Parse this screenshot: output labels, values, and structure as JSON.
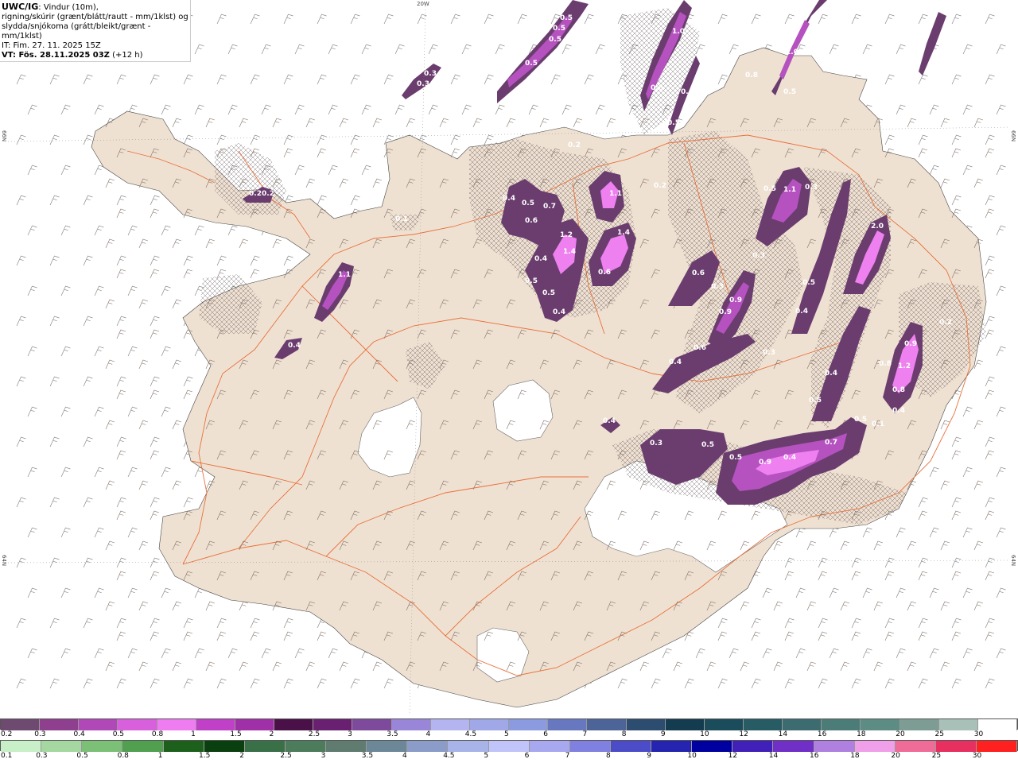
{
  "info": {
    "code": "UWC/IG",
    "line1": ": Vindur (10m),",
    "line2": "rigning/skúrir (grænt/blátt/rautt - mm/1klst) og",
    "line3": "slydda/snjókoma (grátt/bleikt/grænt - mm/1klst)",
    "it": "IT: Fim. 27. 11. 2025 15Z",
    "vt_prefix": "VT: Fös. 28.11.2025 03Z",
    "vt_offset": " (+12 h)"
  },
  "edge_labels": {
    "top_lon": "20W",
    "left_lat_upper": "66N",
    "left_lat_lower": "64N",
    "right_lat_upper": "66N",
    "right_lat_lower": "64N"
  },
  "colors": {
    "land": "#efe1d2",
    "sea": "#ffffff",
    "glacier": "#ffffff",
    "roads": "#e8703a",
    "snow_dark": "#6a3d6e",
    "snow_mid": "#b552c0",
    "snow_light": "#ee80f0"
  },
  "precip_labels": [
    {
      "text": "0.5"
    },
    {
      "text": "0.5"
    },
    {
      "text": "0.5"
    },
    {
      "text": "0.5"
    },
    {
      "text": "0.3"
    },
    {
      "text": "0.3"
    },
    {
      "text": "1.0"
    },
    {
      "text": "0.4"
    },
    {
      "text": "0.8"
    },
    {
      "text": "0.4"
    },
    {
      "text": "0.5"
    },
    {
      "text": "1.0"
    },
    {
      "text": "0.5"
    },
    {
      "text": "0.8"
    },
    {
      "text": "0.5"
    },
    {
      "text": "0.2"
    },
    {
      "text": "0.2"
    },
    {
      "text": "0.1"
    },
    {
      "text": "1.1"
    },
    {
      "text": "0.4"
    },
    {
      "text": "0.5"
    },
    {
      "text": "0.7"
    },
    {
      "text": "0.6"
    },
    {
      "text": "1.2"
    },
    {
      "text": "1.4"
    },
    {
      "text": "0.4"
    },
    {
      "text": "1.1"
    },
    {
      "text": "1.4"
    },
    {
      "text": "0.6"
    },
    {
      "text": "0.5"
    },
    {
      "text": "0.5"
    },
    {
      "text": "0.4"
    },
    {
      "text": "0.2"
    },
    {
      "text": "0.5"
    },
    {
      "text": "1.1"
    },
    {
      "text": "0.3"
    },
    {
      "text": "0.3"
    },
    {
      "text": "0.6"
    },
    {
      "text": "0.3"
    },
    {
      "text": "0.9"
    },
    {
      "text": "0.9"
    },
    {
      "text": "0.5"
    },
    {
      "text": "0.4"
    },
    {
      "text": "2.0"
    },
    {
      "text": "0.6"
    },
    {
      "text": "0.4"
    },
    {
      "text": "0.3"
    },
    {
      "text": "0.4"
    },
    {
      "text": "0.5"
    },
    {
      "text": "0.5"
    },
    {
      "text": "0.4"
    },
    {
      "text": "0.3"
    },
    {
      "text": "0.5"
    },
    {
      "text": "0.5"
    },
    {
      "text": "0.9"
    },
    {
      "text": "0.4"
    },
    {
      "text": "0.8"
    },
    {
      "text": "1.2"
    },
    {
      "text": "0.8"
    },
    {
      "text": "0.9"
    },
    {
      "text": "0.4"
    },
    {
      "text": "0.1"
    },
    {
      "text": "0.4"
    },
    {
      "text": "0.7"
    },
    {
      "text": "0.2"
    },
    {
      "text": "0.2"
    }
  ],
  "legend_snow": {
    "labels": [
      "0.2",
      "0.3",
      "0.4",
      "0.5",
      "0.8",
      "1",
      "1.5",
      "2",
      "2.5",
      "3",
      "3.5",
      "4",
      "4.5",
      "5",
      "6",
      "7",
      "8",
      "9",
      "10",
      "12",
      "14",
      "16",
      "18",
      "20",
      "25",
      "30"
    ],
    "colors": [
      "#6e4a70",
      "#8e3f8e",
      "#b048b8",
      "#d860dc",
      "#f07cf2",
      "#c040c8",
      "#a030a8",
      "#4a1048",
      "#6a2070",
      "#7e4a9c",
      "#9a86d8",
      "#b4b4f0",
      "#a0a8e8",
      "#8c9ae0",
      "#6878c0",
      "#4c6498",
      "#2c4c70",
      "#143c50",
      "#1a4c5c",
      "#285c64",
      "#3c6c70",
      "#4c7c78",
      "#5c8c84",
      "#7c9c94",
      "#a8c0b8",
      "#ffffff"
    ]
  },
  "legend_rain": {
    "labels": [
      "0.1",
      "0.3",
      "0.5",
      "0.8",
      "1",
      "1.5",
      "2",
      "2.5",
      "3",
      "3.5",
      "4",
      "4.5",
      "5",
      "6",
      "7",
      "8",
      "9",
      "10",
      "12",
      "14",
      "16",
      "18",
      "20",
      "25",
      "30"
    ],
    "colors": [
      "#c8f0c8",
      "#a4d8a0",
      "#7cc078",
      "#50a050",
      "#1c601c",
      "#0a4010",
      "#3a7048",
      "#4c7c5c",
      "#607c70",
      "#6c8898",
      "#8c9cc8",
      "#a8b4e8",
      "#c0c4f8",
      "#a8a8f0",
      "#8080e0",
      "#4c4cc8",
      "#2424b0",
      "#0000a0",
      "#4020b8",
      "#7030c8",
      "#b080e0",
      "#f0a0e8",
      "#f06c98",
      "#e83060",
      "#ff2020"
    ]
  }
}
